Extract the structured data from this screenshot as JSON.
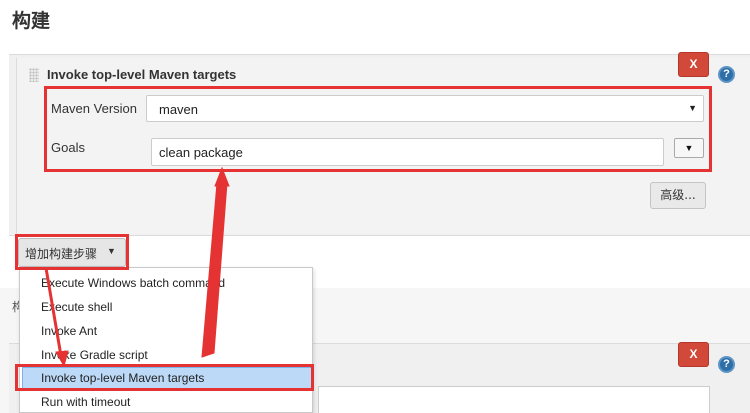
{
  "section": {
    "title": "构建"
  },
  "step": {
    "title": "Invoke top-level Maven targets",
    "delete_label": "X",
    "help_label": "?",
    "maven_version_label": "Maven Version",
    "maven_version_value": "maven",
    "goals_label": "Goals",
    "goals_value": "clean package",
    "expand_label": "▼",
    "advanced_label": "高级..."
  },
  "add_step": {
    "label": "增加构建步骤",
    "caret": "▼"
  },
  "menu": {
    "items": [
      "Execute Windows batch command",
      "Execute shell",
      "Invoke Ant",
      "Invoke Gradle script",
      "Invoke top-level Maven targets",
      "Run with timeout"
    ],
    "selected_index": 4
  },
  "lower_step": {
    "partial_label": "构",
    "delete_label": "X",
    "help_label": "?"
  },
  "annotation_color": "#e53333",
  "selection_color": "#bcd9f7"
}
